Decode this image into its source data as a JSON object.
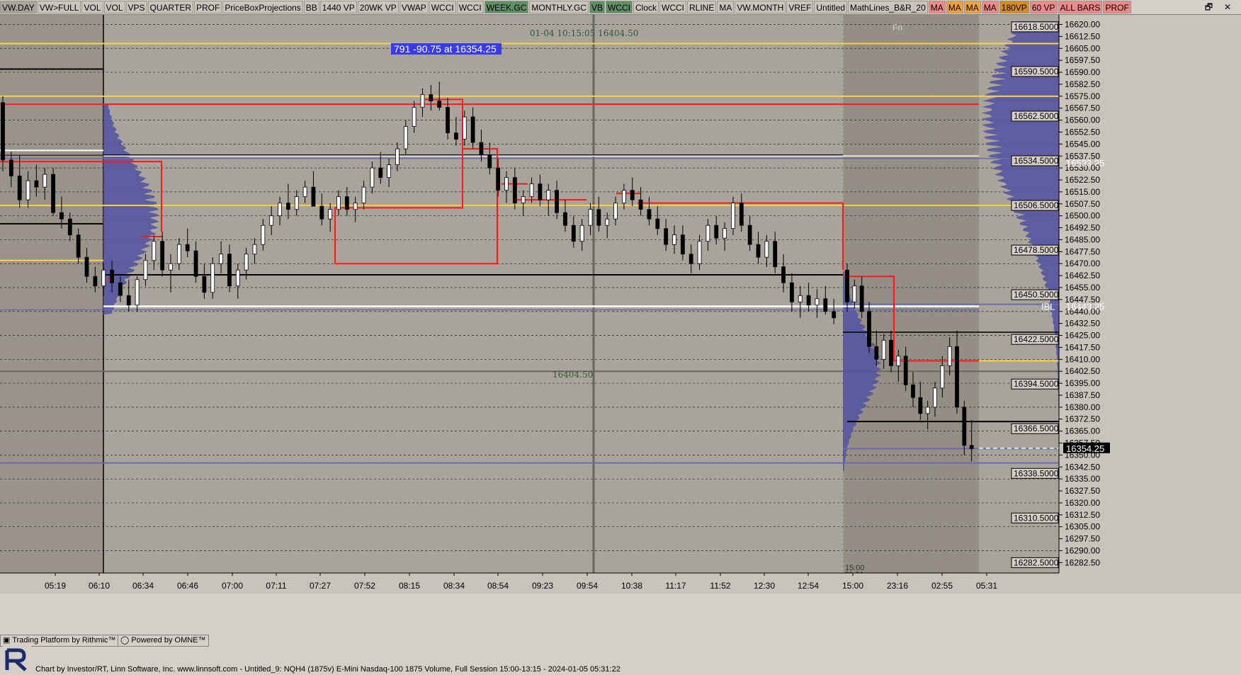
{
  "toolbar": {
    "buttons": [
      {
        "label": "VW.DAY",
        "style": "first"
      },
      {
        "label": "VW>FULL",
        "style": ""
      },
      {
        "label": "VOL",
        "style": ""
      },
      {
        "label": "VOL",
        "style": ""
      },
      {
        "label": "VPS",
        "style": ""
      },
      {
        "label": "QUARTER",
        "style": ""
      },
      {
        "label": "PROF",
        "style": ""
      },
      {
        "label": "PriceBoxProjections",
        "style": ""
      },
      {
        "label": "BB",
        "style": ""
      },
      {
        "label": "1440 VP",
        "style": ""
      },
      {
        "label": "20WK VP",
        "style": ""
      },
      {
        "label": "VWAP",
        "style": ""
      },
      {
        "label": "WCCI",
        "style": ""
      },
      {
        "label": "WCCI",
        "style": ""
      },
      {
        "label": "WEEK.GC",
        "style": "green"
      },
      {
        "label": "MONTHLY.GC",
        "style": ""
      },
      {
        "label": "VB",
        "style": "green"
      },
      {
        "label": "WCCI",
        "style": "green"
      },
      {
        "label": "Clock",
        "style": ""
      },
      {
        "label": "WCCI",
        "style": ""
      },
      {
        "label": "RLINE",
        "style": ""
      },
      {
        "label": "MA",
        "style": ""
      },
      {
        "label": "VW.MONTH",
        "style": ""
      },
      {
        "label": "VREF",
        "style": ""
      },
      {
        "label": "Untitled",
        "style": ""
      },
      {
        "label": "MathLines_B&R_20",
        "style": ""
      },
      {
        "label": "MA",
        "style": "pink"
      },
      {
        "label": "MA",
        "style": "orange"
      },
      {
        "label": "MA",
        "style": "orange"
      },
      {
        "label": "MA",
        "style": "pink"
      },
      {
        "label": "180VP",
        "style": "dark"
      },
      {
        "label": "60 VP",
        "style": "pink"
      },
      {
        "label": "ALL BARS",
        "style": "pink"
      },
      {
        "label": "PROF",
        "style": "pink"
      }
    ],
    "window_controls": "🗗 ✕"
  },
  "colors": {
    "background": "#a8a49c",
    "prior_session": "#9a938a",
    "overnight": "#948e85",
    "profile": "#5555a0",
    "candle": "#000000",
    "red_box": "#ff1a1a",
    "yellow_line": "#ffd040",
    "white_line": "#ffffff",
    "purple_line": "#6a6ab0"
  },
  "chart_data": {
    "type": "candlestick",
    "title": "Chart by Investor/RT, Linn Software, Inc. www.linnsoft.com - Untitled_9: NQH4 (1875v) E-Mini Nasdaq-100 1875 Volume, Full Session 15:00-13:15 - 2024-01-05 05:31:22",
    "instrument": "NQH4",
    "ylim": [
      16276,
      16626
    ],
    "y_ticks": [
      16620.0,
      16612.5,
      16605.0,
      16597.5,
      16590.0,
      16582.5,
      16575.0,
      16567.5,
      16560.0,
      16552.5,
      16545.0,
      16537.5,
      16530.0,
      16522.5,
      16515.0,
      16507.5,
      16500.0,
      16492.5,
      16485.0,
      16477.5,
      16470.0,
      16462.5,
      16455.0,
      16447.5,
      16440.0,
      16432.5,
      16425.0,
      16417.5,
      16410.0,
      16402.5,
      16395.0,
      16387.5,
      16380.0,
      16372.5,
      16365.0,
      16357.5,
      16350.0,
      16342.5,
      16335.0,
      16327.5,
      16320.0,
      16312.5,
      16305.0,
      16297.5,
      16290.0,
      16282.5
    ],
    "price_boxes": [
      "16618.5000",
      "16590.5000",
      "16562.5000",
      "16534.5000",
      "16506.5000",
      "16478.5000",
      "16450.5000",
      "16422.5000",
      "16394.5000",
      "16366.5000",
      "16338.5000",
      "16310.5000",
      "16282.5000"
    ],
    "right_labels": [
      {
        "text": "16533.25",
        "price": 16533.25,
        "kind": "white"
      },
      {
        "text": "IBL",
        "price": 16443.25,
        "kind": "ibl"
      },
      {
        "text": "16443.25",
        "price": 16443.25,
        "kind": "white"
      },
      {
        "text": "16354.25",
        "price": 16354.25,
        "kind": "last"
      }
    ],
    "x_labels": [
      "05:19",
      "06:10",
      "06:34",
      "06:46",
      "07:00",
      "07:11",
      "07:27",
      "07:52",
      "08:15",
      "08:34",
      "08:54",
      "09:23",
      "09:54",
      "10:38",
      "11:17",
      "11:52",
      "12:30",
      "12:54",
      "15:00",
      "23:16",
      "02:55",
      "05:31"
    ],
    "annotations": {
      "info_box": "791  -90.75 at 16354.25",
      "crosshair_label": "01-04 10:15:05  16404.50",
      "crosshair_price": "16404.50",
      "day_label": "Fri",
      "session_start_time": "15:00",
      "session_start_date": "01-04"
    },
    "candles": [
      [
        16571,
        16575,
        16528,
        16535
      ],
      [
        16535,
        16540,
        16518,
        16525
      ],
      [
        16525,
        16538,
        16505,
        16510
      ],
      [
        16510,
        16528,
        16505,
        16522
      ],
      [
        16522,
        16532,
        16512,
        16518
      ],
      [
        16518,
        16530,
        16510,
        16526
      ],
      [
        16526,
        16530,
        16500,
        16502
      ],
      [
        16502,
        16512,
        16492,
        16498
      ],
      [
        16498,
        16502,
        16484,
        16488
      ],
      [
        16488,
        16492,
        16470,
        16474
      ],
      [
        16474,
        16480,
        16458,
        16462
      ],
      [
        16462,
        16468,
        16452,
        16456
      ],
      [
        16456,
        16470,
        16450,
        16466
      ],
      [
        16466,
        16472,
        16452,
        16458
      ],
      [
        16458,
        16462,
        16446,
        16450
      ],
      [
        16450,
        16460,
        16440,
        16444
      ],
      [
        16444,
        16462,
        16440,
        16460
      ],
      [
        16460,
        16476,
        16456,
        16472
      ],
      [
        16472,
        16488,
        16466,
        16484
      ],
      [
        16484,
        16490,
        16462,
        16466
      ],
      [
        16466,
        16476,
        16452,
        16470
      ],
      [
        16470,
        16486,
        16466,
        16482
      ],
      [
        16482,
        16492,
        16474,
        16478
      ],
      [
        16478,
        16484,
        16458,
        16462
      ],
      [
        16462,
        16470,
        16448,
        16452
      ],
      [
        16452,
        16474,
        16448,
        16470
      ],
      [
        16470,
        16484,
        16464,
        16476
      ],
      [
        16476,
        16482,
        16452,
        16456
      ],
      [
        16456,
        16470,
        16448,
        16466
      ],
      [
        16466,
        16480,
        16460,
        16476
      ],
      [
        16476,
        16486,
        16470,
        16482
      ],
      [
        16482,
        16498,
        16478,
        16494
      ],
      [
        16494,
        16506,
        16488,
        16500
      ],
      [
        16500,
        16512,
        16494,
        16508
      ],
      [
        16508,
        16520,
        16498,
        16504
      ],
      [
        16504,
        16516,
        16500,
        16512
      ],
      [
        16512,
        16522,
        16508,
        16518
      ],
      [
        16518,
        16528,
        16512,
        16506
      ],
      [
        16506,
        16514,
        16494,
        16498
      ],
      [
        16498,
        16508,
        16490,
        16504
      ],
      [
        16504,
        16516,
        16500,
        16512
      ],
      [
        16512,
        16518,
        16500,
        16504
      ],
      [
        16504,
        16512,
        16496,
        16508
      ],
      [
        16508,
        16522,
        16504,
        16518
      ],
      [
        16518,
        16534,
        16514,
        16530
      ],
      [
        16530,
        16540,
        16520,
        16524
      ],
      [
        16524,
        16536,
        16518,
        16532
      ],
      [
        16532,
        16546,
        16528,
        16542
      ],
      [
        16542,
        16560,
        16538,
        16556
      ],
      [
        16556,
        16572,
        16552,
        16568
      ],
      [
        16568,
        16580,
        16562,
        16576
      ],
      [
        16576,
        16582,
        16566,
        16572
      ],
      [
        16572,
        16584,
        16566,
        16568
      ],
      [
        16568,
        16574,
        16548,
        16552
      ],
      [
        16552,
        16562,
        16544,
        16548
      ],
      [
        16548,
        16566,
        16544,
        16562
      ],
      [
        16562,
        16568,
        16542,
        16546
      ],
      [
        16546,
        16554,
        16534,
        16538
      ],
      [
        16538,
        16546,
        16526,
        16530
      ],
      [
        16530,
        16536,
        16512,
        16516
      ],
      [
        16516,
        16528,
        16508,
        16524
      ],
      [
        16524,
        16530,
        16504,
        16508
      ],
      [
        16508,
        16516,
        16500,
        16512
      ],
      [
        16512,
        16524,
        16508,
        16520
      ],
      [
        16520,
        16526,
        16506,
        16510
      ],
      [
        16510,
        16520,
        16500,
        16516
      ],
      [
        16516,
        16522,
        16498,
        16502
      ],
      [
        16502,
        16510,
        16490,
        16494
      ],
      [
        16494,
        16500,
        16480,
        16484
      ],
      [
        16484,
        16498,
        16478,
        16494
      ],
      [
        16494,
        16508,
        16488,
        16504
      ],
      [
        16504,
        16512,
        16490,
        16494
      ],
      [
        16494,
        16502,
        16486,
        16498
      ],
      [
        16498,
        16512,
        16494,
        16508
      ],
      [
        16508,
        16520,
        16504,
        16516
      ],
      [
        16516,
        16524,
        16506,
        16510
      ],
      [
        16510,
        16518,
        16500,
        16504
      ],
      [
        16504,
        16512,
        16494,
        16498
      ],
      [
        16498,
        16506,
        16488,
        16492
      ],
      [
        16492,
        16498,
        16478,
        16482
      ],
      [
        16482,
        16494,
        16476,
        16488
      ],
      [
        16488,
        16494,
        16472,
        16476
      ],
      [
        16476,
        16482,
        16464,
        16470
      ],
      [
        16470,
        16488,
        16466,
        16484
      ],
      [
        16484,
        16498,
        16478,
        16494
      ],
      [
        16494,
        16500,
        16482,
        16486
      ],
      [
        16486,
        16496,
        16478,
        16492
      ],
      [
        16492,
        16512,
        16488,
        16508
      ],
      [
        16508,
        16514,
        16490,
        16494
      ],
      [
        16494,
        16500,
        16478,
        16482
      ],
      [
        16482,
        16490,
        16470,
        16474
      ],
      [
        16474,
        16488,
        16468,
        16484
      ],
      [
        16484,
        16490,
        16464,
        16468
      ],
      [
        16468,
        16476,
        16452,
        16458
      ],
      [
        16458,
        16464,
        16440,
        16446
      ],
      [
        16446,
        16456,
        16436,
        16450
      ],
      [
        16450,
        16458,
        16440,
        16444
      ],
      [
        16444,
        16454,
        16436,
        16448
      ],
      [
        16448,
        16456,
        16438,
        16440
      ],
      [
        16440,
        16448,
        16432,
        16436
      ],
      [
        16466,
        16470,
        16440,
        16446
      ],
      [
        16446,
        16460,
        16442,
        16456
      ],
      [
        16456,
        16462,
        16436,
        16440
      ],
      [
        16440,
        16446,
        16414,
        16418
      ],
      [
        16418,
        16428,
        16406,
        16410
      ],
      [
        16410,
        16426,
        16404,
        16422
      ],
      [
        16422,
        16428,
        16402,
        16406
      ],
      [
        16406,
        16416,
        16396,
        16412
      ],
      [
        16412,
        16418,
        16390,
        16394
      ],
      [
        16394,
        16402,
        16380,
        16386
      ],
      [
        16386,
        16396,
        16372,
        16376
      ],
      [
        16376,
        16384,
        16366,
        16380
      ],
      [
        16380,
        16396,
        16374,
        16392
      ],
      [
        16392,
        16412,
        16386,
        16406
      ],
      [
        16406,
        16424,
        16400,
        16418
      ],
      [
        16418,
        16428,
        16376,
        16380
      ],
      [
        16380,
        16384,
        16350,
        16356
      ],
      [
        16356,
        16372,
        16346,
        16354
      ]
    ]
  }
}
